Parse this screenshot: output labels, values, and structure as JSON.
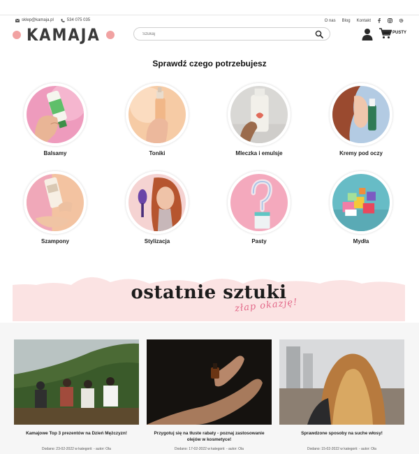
{
  "contact": {
    "email": "sklep@kamaja.pl",
    "phone": "534 075 035"
  },
  "utility_links": [
    "O nas",
    "Blog",
    "Kontakt"
  ],
  "social_icons": [
    "facebook-icon",
    "instagram-icon",
    "settings-icon"
  ],
  "logo": {
    "text": "KAMAJA",
    "dot_color": "#f1a2a2"
  },
  "search": {
    "placeholder": "Szukaj"
  },
  "cart": {
    "label": "PUSTY"
  },
  "categories_section": {
    "title": "Sprawdź czego potrzebujesz",
    "items": [
      {
        "label": "Balsamy"
      },
      {
        "label": "Toniki"
      },
      {
        "label": "Mleczka i emulsje"
      },
      {
        "label": "Kremy pod oczy"
      },
      {
        "label": "Szampony"
      },
      {
        "label": "Stylizacja"
      },
      {
        "label": "Pasty"
      },
      {
        "label": "Mydła"
      }
    ]
  },
  "banner": {
    "headline": "ostatnie sztuki",
    "tagline": "złap okazję!",
    "color": "#fbe3e3"
  },
  "blog_posts": [
    {
      "title": "Kamajowe Top 3 prezentów na Dzień Mężczyzn!",
      "meta": "Dodano: 23-02-2022 w kategorii: - autor: Ola"
    },
    {
      "title": "Przygotuj się na tłuste rabaty - poznaj zastosowanie olejów w kosmetyce!",
      "meta": "Dodano: 17-02-2022 w kategorii: - autor: Ola"
    },
    {
      "title": "Sprawdzone sposoby na suche włosy!",
      "meta": "Dodano: 15-02-2022 w kategorii: - autor: Ola"
    }
  ]
}
